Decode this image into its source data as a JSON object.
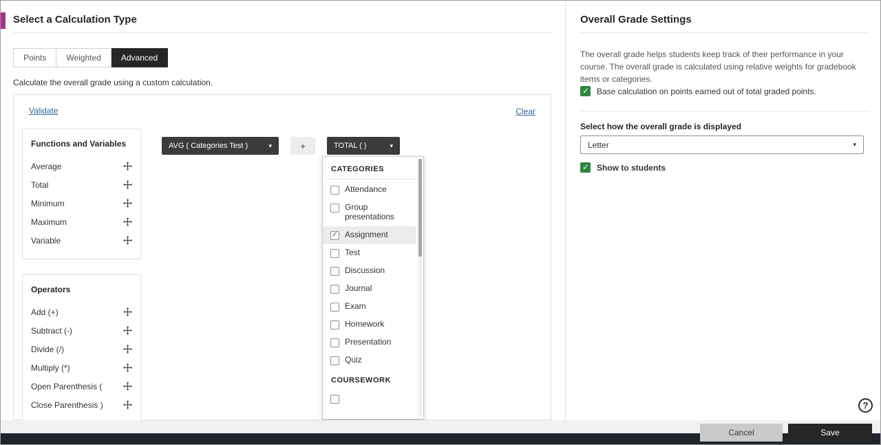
{
  "colors": {
    "accent": "#a1338d",
    "tab_active_bg": "#262626",
    "pill_bg": "#3b3b3b",
    "checkbox_green": "#2e8540",
    "link_blue": "#38678f",
    "footer_dark": "#20242c"
  },
  "icons": {
    "caret_down": "▾",
    "check": "✓",
    "help": "?",
    "move": "move-crosshair"
  },
  "left_panel": {
    "title": "Select a Calculation Type",
    "tabs": [
      {
        "label": "Points",
        "active": false
      },
      {
        "label": "Weighted",
        "active": false
      },
      {
        "label": "Advanced",
        "active": true
      }
    ],
    "description": "Calculate the overall grade using a custom calculation.",
    "validate_link": "Validate",
    "clear_link": "Clear",
    "functions_panel": {
      "title": "Functions and Variables",
      "items": [
        "Average",
        "Total",
        "Minimum",
        "Maximum",
        "Variable"
      ]
    },
    "operators_panel": {
      "title": "Operators",
      "items": [
        "Add (+)",
        "Subtract (-)",
        "Divide (/)",
        "Multiply (*)",
        "Open Parenthesis (",
        "Close Parenthesis )"
      ]
    },
    "expression": {
      "avg_pill": "AVG ( Categories Test )",
      "plus_pill": "+",
      "total_pill": "TOTAL ( )"
    },
    "dropdown": {
      "categories_header": "CATEGORIES",
      "options": [
        {
          "label": "Attendance",
          "checked": false
        },
        {
          "label": "Group presentations",
          "checked": false
        },
        {
          "label": "Assignment",
          "checked": true
        },
        {
          "label": "Test",
          "checked": false
        },
        {
          "label": "Discussion",
          "checked": false
        },
        {
          "label": "Journal",
          "checked": false
        },
        {
          "label": "Exam",
          "checked": false
        },
        {
          "label": "Homework",
          "checked": false
        },
        {
          "label": "Presentation",
          "checked": false
        },
        {
          "label": "Quiz",
          "checked": false
        }
      ],
      "coursework_header": "COURSEWORK"
    }
  },
  "right_panel": {
    "title": "Overall Grade Settings",
    "description": "The overall grade helps students keep track of their performance in your course. The overall grade is calculated using relative weights for gradebook items or categories.",
    "base_calculation": {
      "label": "Base calculation on points earned out of total graded points.",
      "checked": true
    },
    "display_label": "Select how the overall grade is displayed",
    "display_value": "Letter",
    "show_to_students": {
      "label": "Show to students",
      "checked": true
    }
  },
  "footer": {
    "cancel_label": "Cancel",
    "save_label": "Save"
  }
}
